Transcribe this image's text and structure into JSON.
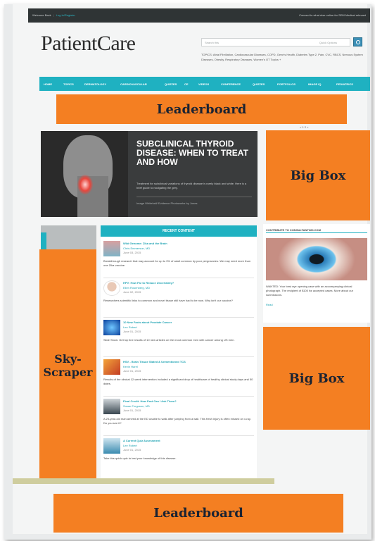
{
  "topbar": {
    "welcome": "Welcome Back",
    "login": "Log In/Register",
    "right_text": "Connect to what else online for SEM Medical relevant"
  },
  "brand": {
    "logo": "PatientCare"
  },
  "search": {
    "placeholder": "Search this",
    "scope": "Quick Options"
  },
  "topics_text": "TOPICS: Atrial Fibrillation, Cardiovascular Diseases, COPD, Gene's Health, Diabetes Type 2, Pain, CVC, RBCS, Nervous System Diseases, Obesity, Respiratory Diseases, Women's OT Topics +",
  "nav": [
    "HOME",
    "TOPICS",
    "DERMATOLOGY",
    "CARDIOVASCULAR",
    "QUIZZES",
    "CE",
    "VIDEOS",
    "CONFERENCE",
    "QUIZZES",
    "PORTFOLIOS",
    "IMAGE IQ",
    "PEDIATRICS"
  ],
  "ads": {
    "leaderboard_top": "Leaderboard",
    "bigbox_top": "Big Box",
    "skyscraper": "Sky-\nScraper",
    "bigbox_bottom": "Big Box",
    "leaderboard_bottom": "Leaderboard"
  },
  "pager": "< 1 2 >",
  "hero": {
    "title": "SUBCLINICAL THYROID DISEASE: WHEN TO TREAT AND HOW",
    "desc": "Treatment for subclinical variations of thyroid disease is rarely black and white. Here is a brief guide to navigating the grey.",
    "meta": "Image Whitehall/ Evidence Photoworks by Jones"
  },
  "recent": {
    "heading": "RECENT CONTENT",
    "items": [
      {
        "title": "Wild Genome: Zika and the Brain",
        "author": "Chris Emmerson, MD",
        "date": "June 03, 2015",
        "excerpt": "Breakthrough research that may account for up to 3% of adult common by poor pregnancies. We may need more than one Zika vaccine."
      },
      {
        "title": "HPV: How Far to Reduce Uncertainty?",
        "author": "Ellen Rosenberg, MD",
        "date": "June 02, 2015",
        "excerpt": "Researchers scientific links to common and novel tissue still have had to be now. Why isn't our vaccine?"
      },
      {
        "title": "10 New Facts about Prostate Cancer",
        "author": "Lee Robert",
        "date": "June 01, 2015",
        "excerpt": "Slide Show: Get top line results of 10 new articles on the most common men with cancer among US men."
      },
      {
        "title": "HSV - Brain Tissue Stated & Unmentioned TCS",
        "author": "Kevin Harel",
        "date": "June 01, 2015",
        "excerpt": "Results of the clinical 12-week intervention included a significant drop of healthcare of healthy clinical study days and 50 dates."
      },
      {
        "title": "Final Credit: How Fast Can I Ask Them?",
        "author": "Susan Ferguson, MD",
        "date": "June 01, 2015",
        "excerpt": "A 25-year-old man arrived at the ED unable to walk after jumping from a wall. This fresh injury is often missed on x-ray. Do you see it?"
      },
      {
        "title": "A Current Quiz Assessment",
        "author": "Lee Robert",
        "date": "June 01, 2015",
        "excerpt": "Take this quick quiz to test your knowledge of this disease."
      }
    ]
  },
  "contributor": {
    "heading": "CONTRIBUTE TO CONSULTANT360.COM",
    "caption": "WANTED: Your best eye opening case with an accompanying clinical photograph. The recipient of $100 for accepted cases. More about our submissions.",
    "more": "Read"
  }
}
